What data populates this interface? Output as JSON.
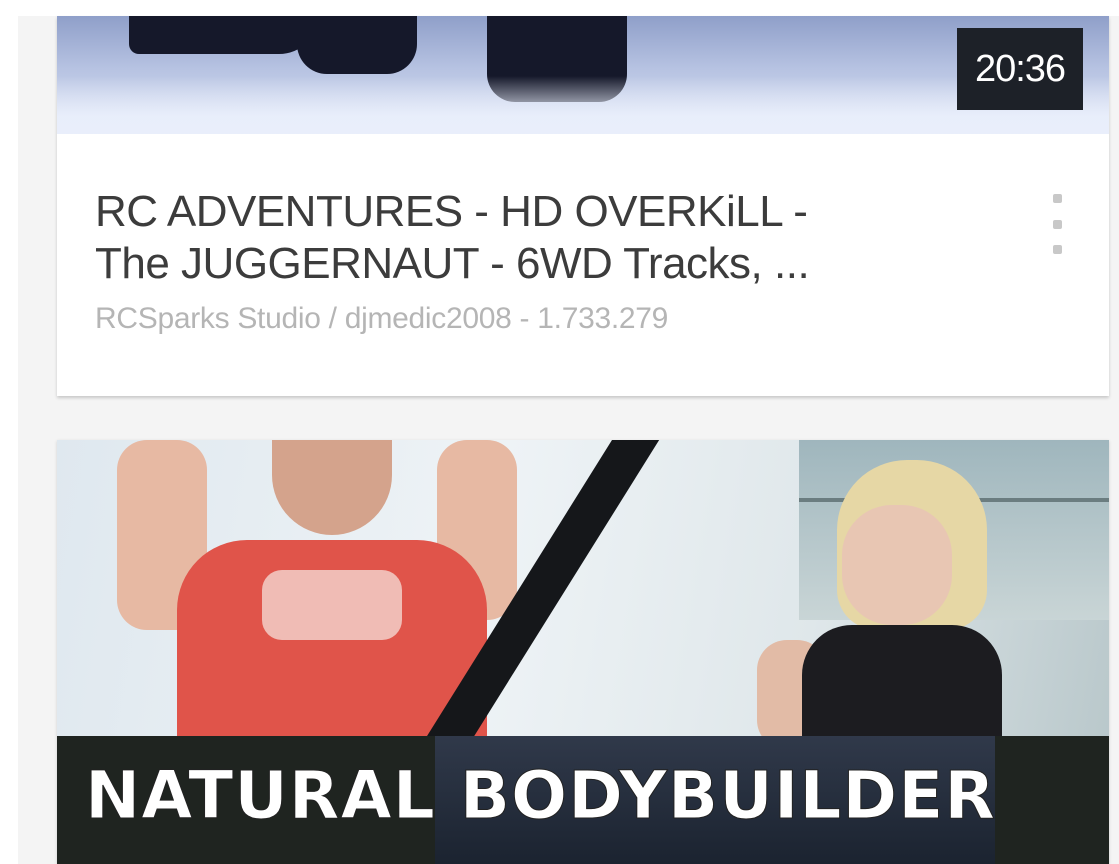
{
  "videos": [
    {
      "duration": "20:36",
      "title": "RC ADVENTURES - HD OVERKiLL -\nThe JUGGERNAUT - 6WD Tracks, ...",
      "channel_line": "RCSparks Studio / djmedic2008 - 1.733.279",
      "menu_icon": "more-vert-icon"
    },
    {
      "thumbnail_caption": "NATURAL BODYBUILDER"
    }
  ],
  "colors": {
    "duration_badge": "#1d2128",
    "title_text": "#3c3c3c",
    "meta_text": "#b5b5b5",
    "card_background": "#ffffff",
    "page_background": "#f4f4f4"
  }
}
